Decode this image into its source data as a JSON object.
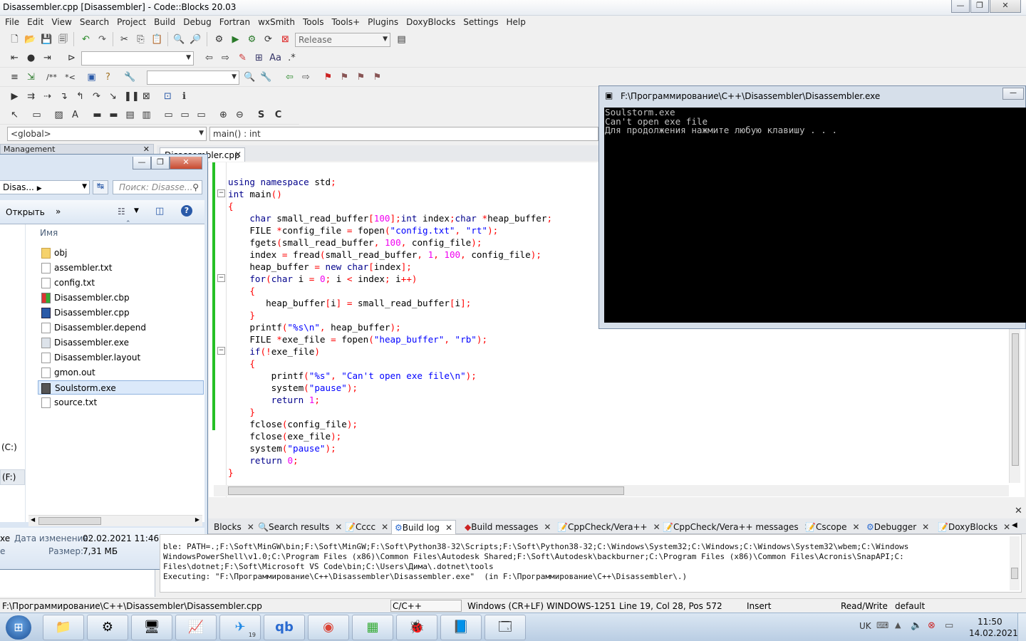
{
  "window": {
    "title": "Disassembler.cpp [Disassembler] - Code::Blocks 20.03"
  },
  "menu": [
    "File",
    "Edit",
    "View",
    "Search",
    "Project",
    "Build",
    "Debug",
    "Fortran",
    "wxSmith",
    "Tools",
    "Tools+",
    "Plugins",
    "DoxyBlocks",
    "Settings",
    "Help"
  ],
  "toolbar": {
    "build_target": "Release"
  },
  "scope": {
    "global": "<global>",
    "function": "main() : int"
  },
  "management": {
    "title": "Management"
  },
  "explorer": {
    "breadcrumb": "Disas...",
    "search_placeholder": "Поиск: Disasse...",
    "open_label": "Открыть",
    "more_label": "»",
    "column_name": "Имя",
    "files": [
      {
        "name": "obj",
        "icon": "folder-icon"
      },
      {
        "name": "assembler.txt",
        "icon": "text-file-icon"
      },
      {
        "name": "config.txt",
        "icon": "text-file-icon"
      },
      {
        "name": "Disassembler.cbp",
        "icon": "cbp-file-icon"
      },
      {
        "name": "Disassembler.cpp",
        "icon": "cpp-file-icon"
      },
      {
        "name": "Disassembler.depend",
        "icon": "file-icon"
      },
      {
        "name": "Disassembler.exe",
        "icon": "exe-file-icon"
      },
      {
        "name": "Disassembler.layout",
        "icon": "file-icon"
      },
      {
        "name": "gmon.out",
        "icon": "file-icon"
      },
      {
        "name": "Soulstorm.exe",
        "icon": "exe-file-icon"
      },
      {
        "name": "source.txt",
        "icon": "text-file-icon"
      }
    ],
    "drive_c": "(C:)",
    "drive_f": "(F:)",
    "details": {
      "ext": "xe",
      "date_label": "Дата изменения:",
      "date_value": "02.02.2021 11:46",
      "size_label": "Размер:",
      "size_value": "7,31 МБ",
      "ext2": "е"
    }
  },
  "editor": {
    "tab": "Disassembler.cpp",
    "lines": [
      "using namespace std;",
      "int main()",
      "{",
      "    char small_read_buffer[100];int index;char *heap_buffer;",
      "    FILE *config_file = fopen(\"config.txt\", \"rt\");",
      "    fgets(small_read_buffer, 100, config_file);",
      "    index = fread(small_read_buffer, 1, 100, config_file);",
      "    heap_buffer = new char[index];",
      "    for(char i = 0; i < index; i++)",
      "    {",
      "       heap_buffer[i] = small_read_buffer[i];",
      "    }",
      "    printf(\"%s\\n\", heap_buffer);",
      "    FILE *exe_file = fopen(\"heap_buffer\", \"rb\");",
      "    if(!exe_file)",
      "    {",
      "        printf(\"%s\", \"Can't open exe file\\n\");",
      "        system(\"pause\");",
      "        return 1;",
      "    }",
      "    fclose(config_file);",
      "    fclose(exe_file);",
      "    system(\"pause\");",
      "    return 0;",
      "}"
    ]
  },
  "console": {
    "title": "F:\\Программирование\\C++\\Disassembler\\Disassembler.exe",
    "output": "Soulstorm.exe\nCan't open exe file\nДля продолжения нажмите любую клавишу . . ."
  },
  "logs": {
    "tabs": [
      "Blocks",
      "Search results",
      "Cccc",
      "Build log",
      "Build messages",
      "CppCheck/Vera++",
      "CppCheck/Vera++ messages",
      "Cscope",
      "Debugger",
      "DoxyBlocks"
    ],
    "active": "Build log",
    "lines": [
      "ble: PATH=.;F:\\Soft\\MinGW\\bin;F:\\Soft\\MinGW;F:\\Soft\\Python38-32\\Scripts;F:\\Soft\\Python38-32;C:\\Windows\\System32;C:\\Windows;C:\\Windows\\System32\\wbem;C:\\Windows",
      "WindowsPowerShell\\v1.0;C:\\Program Files (x86)\\Common Files\\Autodesk Shared;F:\\Soft\\Autodesk\\backburner;C:\\Program Files (x86)\\Common Files\\Acronis\\SnapAPI;C:",
      "Files\\dotnet;F:\\Soft\\Microsoft VS Code\\bin;C:\\Users\\Дима\\.dotnet\\tools",
      "Executing: \"F:\\Программирование\\C++\\Disassembler\\Disassembler.exe\"  (in F:\\Программирование\\C++\\Disassembler\\.)"
    ]
  },
  "status": {
    "path": "F:\\Программирование\\C++\\Disassembler\\Disassembler.cpp",
    "lang": "C/C++",
    "eol": "Windows (CR+LF)",
    "encoding": "WINDOWS-1251",
    "position": "Line 19, Col 28, Pos 572",
    "mode": "Insert",
    "access": "Read/Write",
    "theme": "default"
  },
  "taskbar": {
    "lang": "UK",
    "time": "11:50",
    "date": "14.02.2021",
    "telegram_badge": "19"
  },
  "colors": {
    "keyword": "#00008b",
    "number": "#f000f0",
    "string": "#0000ff",
    "operator": "#ff0000",
    "console_bg": "#000000",
    "console_fg": "#c0c0c0"
  }
}
